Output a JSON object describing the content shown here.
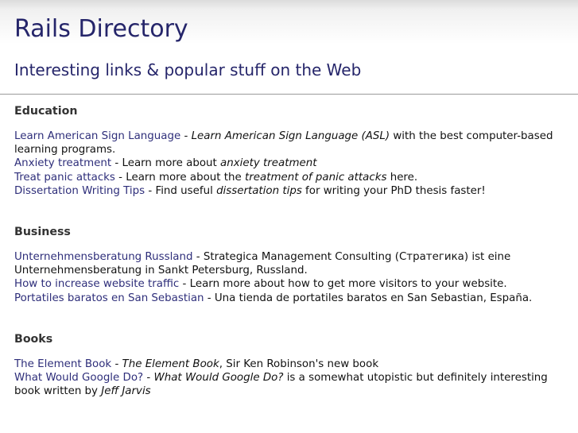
{
  "header": {
    "title": "Rails Directory",
    "tagline": "Interesting links & popular stuff on the Web"
  },
  "sections": [
    {
      "heading": "Education",
      "entries": [
        {
          "link": "Learn American Sign Language",
          "parts": [
            " - ",
            {
              "em": "Learn American Sign Language (ASL)"
            },
            " with the best computer-based learning programs."
          ]
        },
        {
          "link": "Anxiety treatment",
          "parts": [
            " - Learn more about ",
            {
              "em": "anxiety treatment"
            }
          ]
        },
        {
          "link": "Treat panic attacks",
          "parts": [
            " - Learn more about the ",
            {
              "em": "treatment of panic attacks"
            },
            " here."
          ]
        },
        {
          "link": "Dissertation Writing Tips",
          "parts": [
            " - Find useful ",
            {
              "em": "dissertation tips"
            },
            " for writing your PhD thesis faster!"
          ]
        }
      ]
    },
    {
      "heading": "Business",
      "entries": [
        {
          "link": "Unternehmensberatung Russland",
          "parts": [
            " - Strategica Management Consulting (Стратегика) ist eine Unternehmensberatung in Sankt Petersburg, Russland."
          ]
        },
        {
          "link": "How to increase website traffic",
          "parts": [
            " - Learn more about how to get more visitors to your website."
          ]
        },
        {
          "link": "Portatiles baratos en San Sebastian",
          "parts": [
            " - Una tienda de portatiles baratos en San Sebastian, España."
          ]
        }
      ]
    },
    {
      "heading": "Books",
      "entries": [
        {
          "link": "The Element Book",
          "parts": [
            " - ",
            {
              "em": "The Element Book"
            },
            ", Sir Ken Robinson's new book"
          ]
        },
        {
          "link": "What Would Google Do?",
          "parts": [
            " - ",
            {
              "em": "What Would Google Do?"
            },
            " is a somewhat utopistic but definitely interesting book written by ",
            {
              "em": "Jeff Jarvis"
            }
          ]
        }
      ]
    }
  ]
}
